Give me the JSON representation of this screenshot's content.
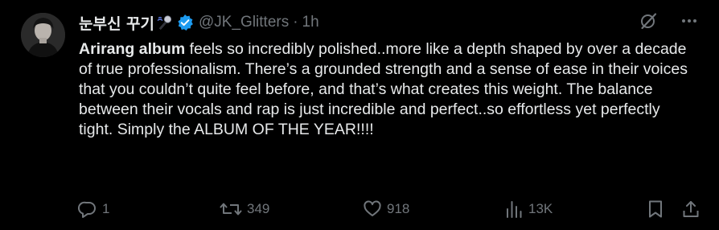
{
  "author": {
    "display_name": "눈부신 꾸기",
    "handle": "@JK_Glitters",
    "separator": "·",
    "time": "1h"
  },
  "tweet": {
    "bold_lead": "Arirang album",
    "text": " feels so incredibly polished..more like a depth shaped by over a decade of true professionalism. There’s a grounded strength and a sense of ease in their voices that you couldn’t quite feel before, and that’s what creates this weight. The balance between their vocals and rap is just incredible and perfect..so effortless yet perfectly tight. Simply the ALBUM OF THE YEAR!!!!"
  },
  "actions": {
    "replies": "1",
    "reposts": "349",
    "likes": "918",
    "views": "13K"
  },
  "icons": {
    "mic": "microphone-icon",
    "verified": "verified-badge-icon",
    "grok": "grok-icon",
    "more": "more-icon",
    "reply": "reply-icon",
    "repost": "repost-icon",
    "like": "heart-icon",
    "views": "views-icon",
    "bookmark": "bookmark-icon",
    "share": "share-icon"
  },
  "colors": {
    "background": "#000000",
    "text": "#e7e9ea",
    "muted": "#71767b",
    "verified": "#1d9bf0"
  }
}
